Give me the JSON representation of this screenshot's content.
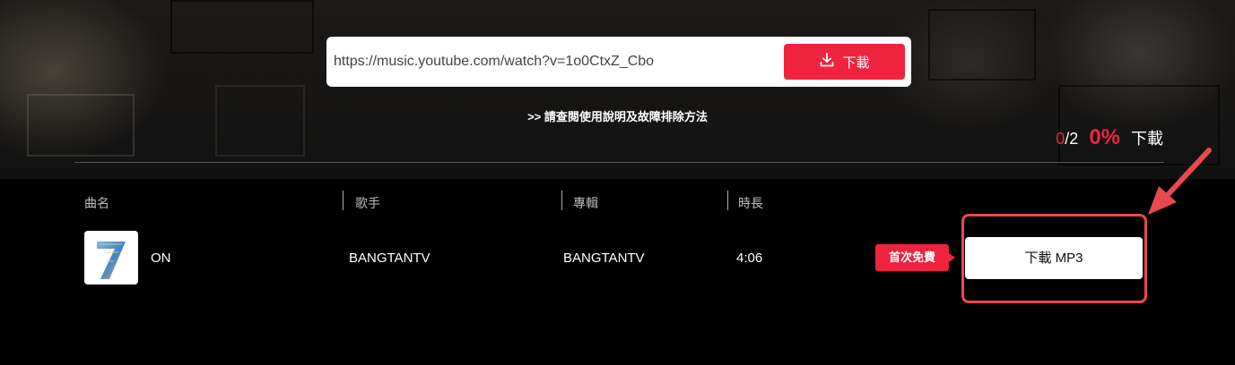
{
  "url_input": {
    "value": "https://music.youtube.com/watch?v=1o0CtxZ_Cbo"
  },
  "download_button": {
    "label": "下載",
    "icon": "download-icon"
  },
  "help_link": ">> 請查閱使用說明及故障排除方法",
  "progress": {
    "done": "0",
    "total": "/2",
    "percent": "0%",
    "label": "下載"
  },
  "table": {
    "columns": [
      "曲名",
      "歌手",
      "專輯",
      "時長"
    ],
    "rows": [
      {
        "cover": "album-cover-7",
        "title": "ON",
        "artist": "BANGTANTV",
        "album": "BANGTANTV",
        "duration": "4:06",
        "badge": "首次免費",
        "action": "下載 MP3"
      }
    ]
  },
  "colors": {
    "accent": "#f0233f",
    "highlight": "#e8494f",
    "background": "#000000"
  }
}
